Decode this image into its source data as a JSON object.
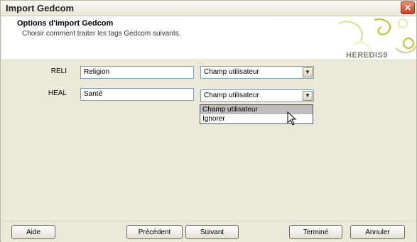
{
  "window": {
    "title": "Import Gedcom",
    "close_glyph": "✕"
  },
  "header": {
    "title": "Options d'import Gedcom",
    "subtitle": "Choisir comment traiter les tags Gedcom suivants.",
    "logo_text": "HEREDIS9"
  },
  "rows": [
    {
      "tag": "RELI",
      "value": "Religion",
      "selected": "Champ utilisateur"
    },
    {
      "tag": "HEAL",
      "value": "Santé",
      "selected": "Champ utilisateur"
    }
  ],
  "dropdown": {
    "options": [
      "Champ utilisateur",
      "Ignorer"
    ],
    "highlighted_index": 0
  },
  "footer": {
    "help": "Aide",
    "previous": "Précédent",
    "next": "Suivant",
    "finish": "Terminé",
    "cancel": "Annuler"
  },
  "colors": {
    "accent_green": "#b4c61e",
    "close_red": "#c1432a"
  },
  "icons": {
    "close": "close-icon",
    "arrow": "chevron-down-icon",
    "cursor": "mouse-cursor-icon"
  }
}
